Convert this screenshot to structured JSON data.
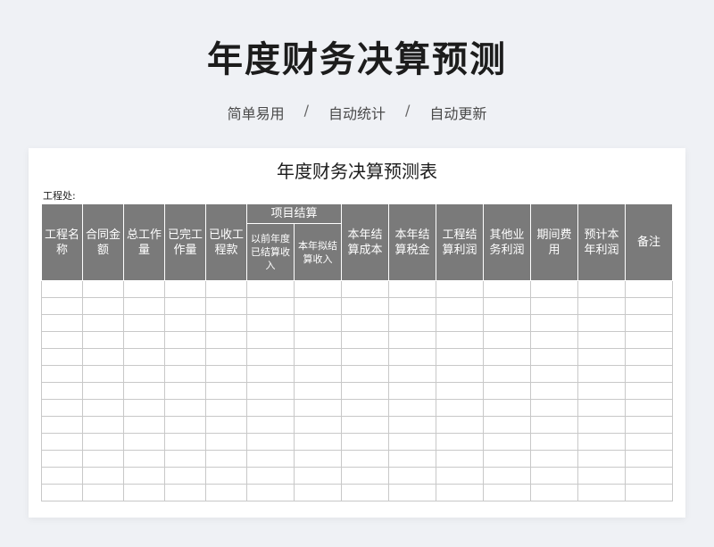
{
  "page": {
    "title": "年度财务决算预测",
    "tags": [
      "简单易用",
      "自动统计",
      "自动更新"
    ],
    "separator": "/"
  },
  "sheet": {
    "title": "年度财务决算预测表",
    "project_label": "工程处:",
    "group_header": "项目结算",
    "columns": [
      "工程名称",
      "合同金额",
      "总工作量",
      "已完工作量",
      "已收工程款",
      "以前年度已结算收入",
      "本年拟结算收入",
      "本年结算成本",
      "本年结算税金",
      "工程结算利润",
      "其他业务利润",
      "期间费用",
      "预计本年利润",
      "备注"
    ],
    "empty_rows": 13
  }
}
